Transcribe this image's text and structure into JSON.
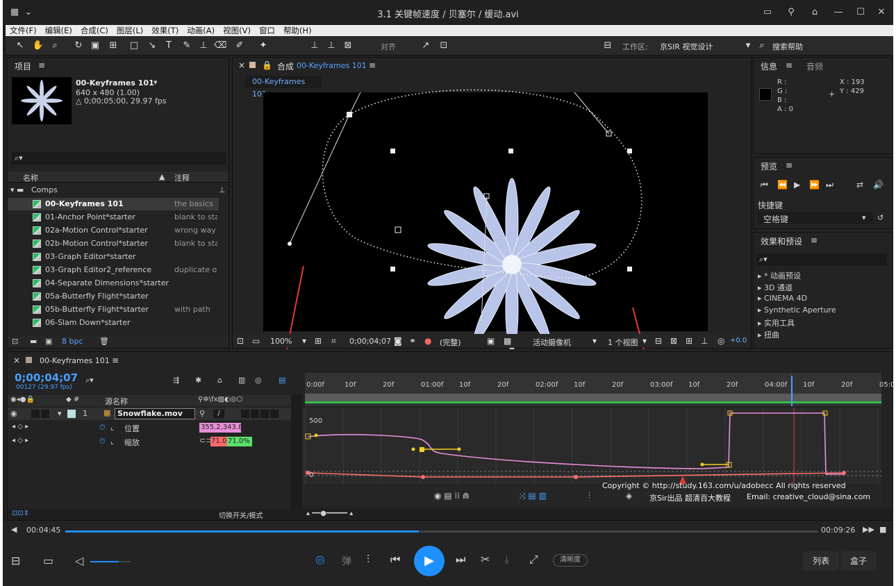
{
  "window": {
    "title": "3.1 关键帧速度 / 贝塞尔 / 缓动.avi"
  },
  "menu": [
    "文件(F)",
    "编辑(E)",
    "合成(C)",
    "图层(L)",
    "效果(T)",
    "动画(A)",
    "视图(V)",
    "窗口",
    "帮助(H)"
  ],
  "toolbar": {
    "snap_label": "对齐",
    "workspace_label": "工作区:",
    "workspace_value": "京SIR 视觉设计",
    "search_help": "搜索帮助"
  },
  "project": {
    "tab": "项目",
    "comp_name": "00-Keyframes 101",
    "comp_size": "640 x 480 (1.00)",
    "comp_duration": "△ 0;00;05;00, 29.97 fps",
    "col_name": "名称",
    "col_comment": "注释",
    "folder": "Comps",
    "items": [
      {
        "name": "00-Keyframes 101",
        "comment": "the basics"
      },
      {
        "name": "01-Anchor Point*starter",
        "comment": "blank to sta"
      },
      {
        "name": "02a-Motion Control*starter",
        "comment": "wrong way"
      },
      {
        "name": "02b-Motion Control*starter",
        "comment": "blank to sta"
      },
      {
        "name": "03-Graph Editor*starter",
        "comment": ""
      },
      {
        "name": "03-Graph Editor2_reference",
        "comment": "duplicate of"
      },
      {
        "name": "04-Separate Dimensions*starter",
        "comment": ""
      },
      {
        "name": "05a-Butterfly Flight*starter",
        "comment": ""
      },
      {
        "name": "05b-Butterfly Flight*starter",
        "comment": "with path"
      },
      {
        "name": "06-Slam Down*starter",
        "comment": ""
      }
    ],
    "bpc": "8 bpc"
  },
  "composition": {
    "tab_prefix": "合成",
    "tab_name": "00-Keyframes 101",
    "subtab": "00-Keyframes 101",
    "zoom": "100%",
    "timecode": "0;00;04;07",
    "quality": "(完整)",
    "camera": "活动摄像机",
    "views": "1 个视图",
    "exposure": "+0.0"
  },
  "info": {
    "tab_info": "信息",
    "tab_audio": "音频",
    "r": "R :",
    "g": "G :",
    "b": "B :",
    "a": "A : 0",
    "x": "X : 193",
    "y": "Y : 429"
  },
  "preview": {
    "tab": "预览",
    "shortcut_label": "快捷键",
    "shortcut_value": "空格键"
  },
  "effects": {
    "tab": "效果和预设",
    "items": [
      "* 动画预设",
      "3D 通道",
      "CINEMA 4D",
      "Synthetic Aperture",
      "实用工具",
      "扭曲"
    ]
  },
  "timeline": {
    "tab": "00-Keyframes 101",
    "timecode": "0;00;04;07",
    "frames": "00127 (29.97 fps)",
    "col_source": "源名称",
    "layer_num": "1",
    "layer_name": "Snowflake.mov",
    "prop_position": "位置",
    "position_value": "355.2,343.8",
    "prop_scale": "缩放",
    "scale_x": "71.0,",
    "scale_y": "71.0%",
    "toggle_mode": "切换开关/模式",
    "ruler": [
      "0:00f",
      "10f",
      "20f",
      "01:00f",
      "10f",
      "20f",
      "02:00f",
      "10f",
      "20f",
      "03:00f",
      "10f",
      "20f",
      "04:00f",
      "10f",
      "20f",
      "05:00"
    ],
    "graph_500": "500",
    "graph_0": "0"
  },
  "watermark": {
    "line1": "Copyright © http://study.163.com/u/adobecc All rights reserved",
    "line2": "Email: creative_cloud@sina.com",
    "line3": "京Sir出品 超清百大教程"
  },
  "player": {
    "current": "00:04:45",
    "total": "00:09:26",
    "progress": 0.47,
    "volume": 0.7,
    "bullet": "弹",
    "clarity": "清晰度",
    "list": "列表",
    "box": "盒子"
  },
  "colors": {
    "accent": "#1e90ff",
    "path": "#e8e8e8",
    "graph_pink": "#e890d8",
    "graph_red": "#ff6060"
  }
}
